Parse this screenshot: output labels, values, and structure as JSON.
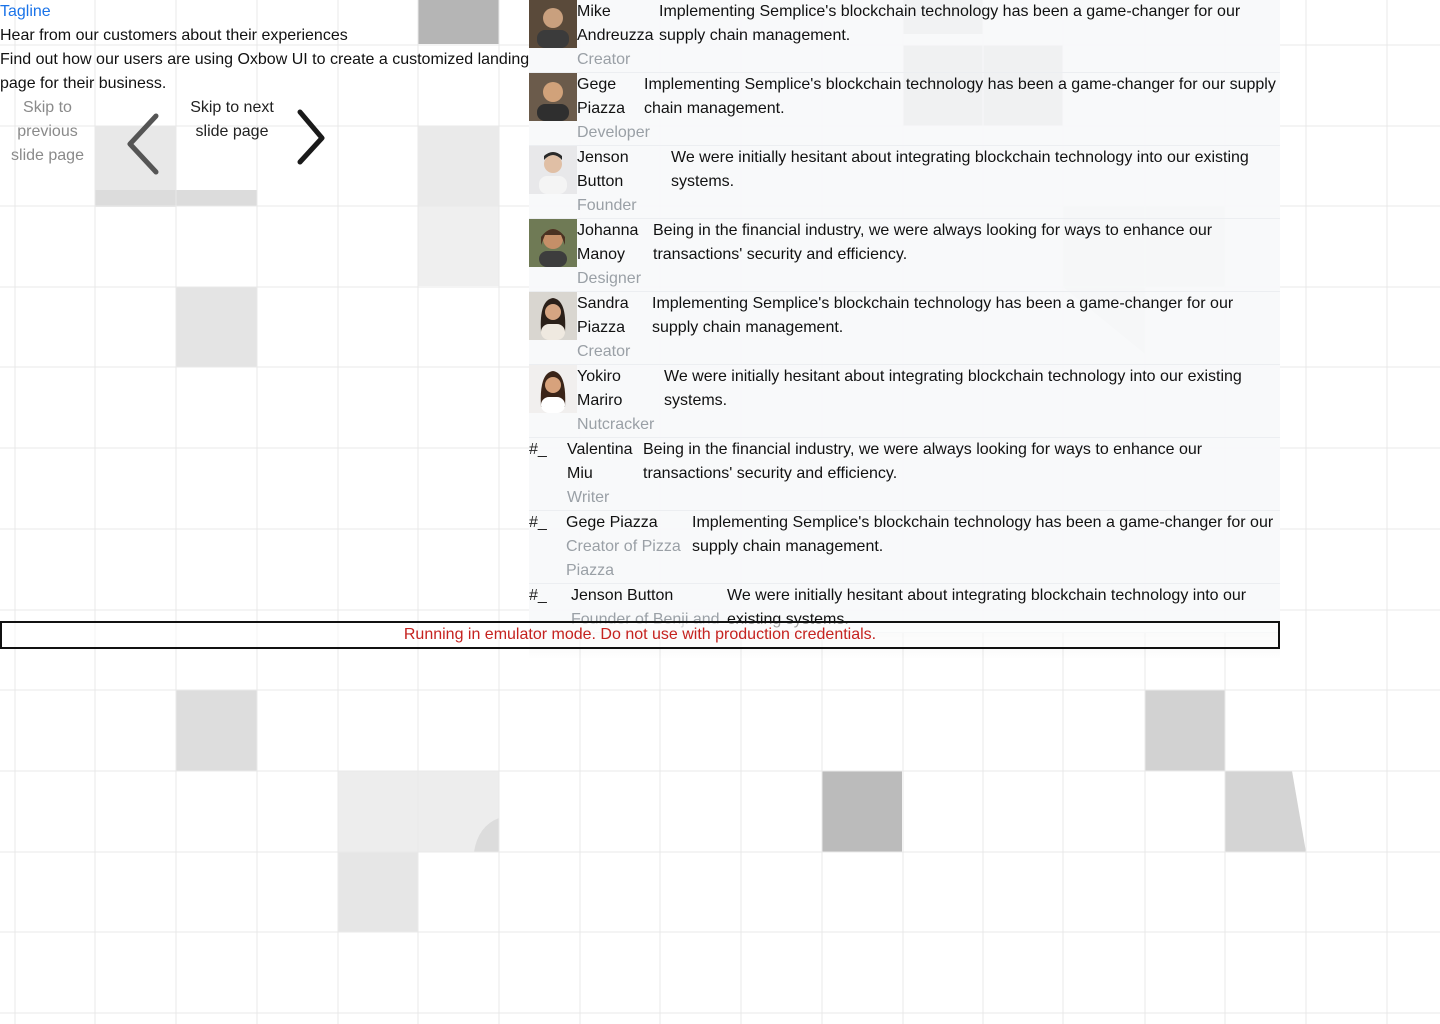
{
  "header": {
    "tagline": "Tagline",
    "subtitle": "Hear from our customers about their experiences",
    "description": "Find out how our users are using Oxbow UI to create a customized landing page for their business."
  },
  "carousel": {
    "prev_label": "Skip to previous slide page",
    "next_label": "Skip to next slide page"
  },
  "testimonials": [
    {
      "name": "Mike Andreuzza",
      "role": "Creator",
      "quote": "Implementing Semplice's blockchain technology has been a game-changer for our supply chain management.",
      "avatar": "photo"
    },
    {
      "name": "Gege Piazza",
      "role": "Developer",
      "quote": "Implementing Semplice's blockchain technology has been a game-changer for our supply chain management.",
      "avatar": "photo"
    },
    {
      "name": "Jenson Button",
      "role": "Founder",
      "quote": "We were initially hesitant about integrating blockchain technology into our existing systems.",
      "avatar": "photo"
    },
    {
      "name": "Johanna Manoy",
      "role": "Designer",
      "quote": "Being in the financial industry, we were always looking for ways to enhance our transactions' security and efficiency.",
      "avatar": "photo"
    },
    {
      "name": "Sandra Piazza",
      "role": "Creator",
      "quote": "Implementing Semplice's blockchain technology has been a game-changer for our supply chain management.",
      "avatar": "photo"
    },
    {
      "name": "Yokiro Mariro",
      "role": "Nutcracker",
      "quote": "We were initially hesitant about integrating blockchain technology into our existing systems.",
      "avatar": "photo"
    },
    {
      "name": "Valentina Miu",
      "role": "Writer",
      "quote": "Being in the financial industry, we were always looking for ways to enhance our transactions' security and efficiency.",
      "avatar": "broken",
      "broken_alt": "#_"
    },
    {
      "name": "Gege Piazza",
      "role": "Creator of Pizza Piazza",
      "quote": "Implementing Semplice's blockchain technology has been a game-changer for our supply chain management.",
      "avatar": "broken",
      "broken_alt": "#_"
    },
    {
      "name": "Jenson Button",
      "role": "Founder of Benji and",
      "quote": "We were initially hesitant about integrating blockchain technology into our existing systems.",
      "avatar": "broken",
      "broken_alt": "#_"
    }
  ],
  "notice": {
    "text": "Running in emulator mode. Do not use with production credentials.",
    "color": "#c5221f"
  },
  "colors": {
    "accent": "#1a73e8",
    "muted": "#9aa0a6",
    "card_bg": "#f7f8fa"
  }
}
